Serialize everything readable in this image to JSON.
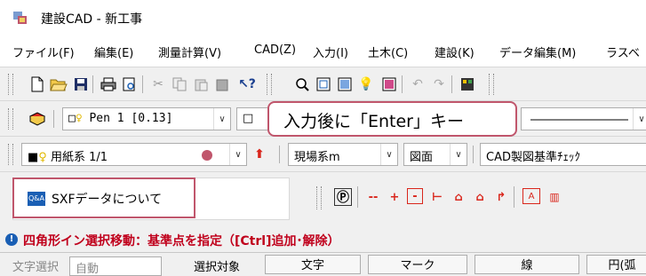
{
  "window": {
    "title": "建設CAD - 新工事"
  },
  "menu": [
    "ファイル(F)",
    "編集(E)",
    "測量計算(V)",
    "CAD(Z)",
    "入力(I)",
    "土木(C)",
    "建設(K)",
    "データ編集(M)",
    "ラスベ"
  ],
  "toolbar_pen": {
    "pen_value": "Pen 1 [0.13]",
    "second_prefix": "□"
  },
  "callout": {
    "text": "入力後に「Enter」キー"
  },
  "toolbar_scale": {
    "paper": "用紙系 1/1",
    "coord": "現場系m",
    "view": "図面",
    "check": "CAD製図基準ﾁｪｯｸ"
  },
  "sxf_panel": {
    "label": "SXFデータについて",
    "badge": "Q&A"
  },
  "status": {
    "message": "四角形イン選択移動：基準点を指定（[Ctrl]追加･解除）"
  },
  "bottom_bar": {
    "filter_label": "文字選択",
    "filter_value": "自動",
    "select_label": "選択対象",
    "buttons": [
      "文字",
      "マーク",
      "線",
      "円(弧"
    ]
  },
  "colors": {
    "accent_red": "#d9261c",
    "highlight_frame": "#c0566c",
    "status_text": "#c0001c"
  }
}
